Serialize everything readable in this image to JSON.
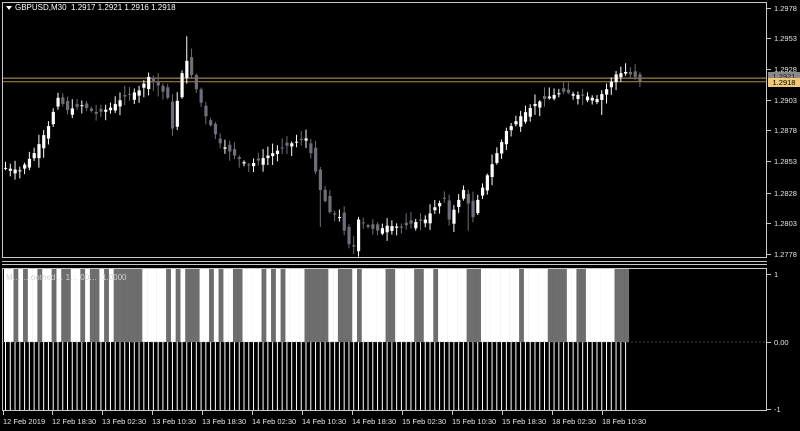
{
  "header": {
    "symbol": "GBPUSD,M30",
    "ohlc": "1.2917 1.2921 1.2916 1.2918"
  },
  "indicator": {
    "label": "M… …oothed… 1… 00… -1.0000"
  },
  "price_axis": {
    "ticks": [
      "1.2978",
      "1.2953",
      "1.2928",
      "1.2903",
      "1.2878",
      "1.2853",
      "1.2828",
      "1.2803",
      "1.2778"
    ],
    "bid_label": "1.2918",
    "ask_label": "1.2921"
  },
  "indicator_axis": {
    "ticks": [
      "1",
      "0.00",
      "-1"
    ]
  },
  "time_axis": {
    "ticks": [
      "12 Feb 2019",
      "12 Feb 18:30",
      "13 Feb 02:30",
      "13 Feb 10:30",
      "13 Feb 18:30",
      "14 Feb 02:30",
      "14 Feb 10:30",
      "14 Feb 18:30",
      "15 Feb 02:30",
      "15 Feb 10:30",
      "15 Feb 18:30",
      "18 Feb 02:30",
      "18 Feb 10:30"
    ]
  },
  "colors": {
    "background": "#000000",
    "bull": "#ffffff",
    "bear": "#6e6e78",
    "frame": "#c8c8c8",
    "bid_line": "#b08a4a",
    "ask_line": "#c0a060",
    "histogram": "#ffffff",
    "state_on": "#ffffff",
    "state_off": "#6e6e6e"
  },
  "chart_data": {
    "type": "candlestick",
    "price_range": [
      1.2768,
      1.2988
    ],
    "close_path": [
      [
        0,
        1.2848
      ],
      [
        3,
        1.2846
      ],
      [
        6,
        1.286
      ],
      [
        9,
        1.2882
      ],
      [
        11,
        1.2905
      ],
      [
        13,
        1.2895
      ],
      [
        16,
        1.2899
      ],
      [
        19,
        1.2892
      ],
      [
        22,
        1.2897
      ],
      [
        25,
        1.2906
      ],
      [
        28,
        1.2911
      ],
      [
        30,
        1.2922
      ],
      [
        32,
        1.2915
      ],
      [
        34,
        1.2905
      ],
      [
        35,
        1.288
      ],
      [
        37,
        1.2925
      ],
      [
        38,
        1.2935
      ],
      [
        40,
        1.2912
      ],
      [
        42,
        1.289
      ],
      [
        45,
        1.2868
      ],
      [
        48,
        1.2858
      ],
      [
        51,
        1.285
      ],
      [
        54,
        1.2856
      ],
      [
        57,
        1.2862
      ],
      [
        60,
        1.2868
      ],
      [
        63,
        1.2872
      ],
      [
        64,
        1.286
      ],
      [
        66,
        1.283
      ],
      [
        68,
        1.2812
      ],
      [
        70,
        1.2808
      ],
      [
        72,
        1.2786
      ],
      [
        73,
        1.2784
      ],
      [
        74,
        1.2806
      ],
      [
        76,
        1.28
      ],
      [
        78,
        1.2797
      ],
      [
        80,
        1.2801
      ],
      [
        83,
        1.28
      ],
      [
        86,
        1.2804
      ],
      [
        88,
        1.2806
      ],
      [
        90,
        1.2816
      ],
      [
        92,
        1.2823
      ],
      [
        93,
        1.2806
      ],
      [
        95,
        1.2822
      ],
      [
        96,
        1.283
      ],
      [
        98,
        1.2808
      ],
      [
        99,
        1.2822
      ],
      [
        101,
        1.2842
      ],
      [
        103,
        1.286
      ],
      [
        105,
        1.2878
      ],
      [
        108,
        1.289
      ],
      [
        111,
        1.29
      ],
      [
        114,
        1.2906
      ],
      [
        117,
        1.291
      ],
      [
        119,
        1.2908
      ],
      [
        122,
        1.2906
      ],
      [
        124,
        1.2904
      ],
      [
        126,
        1.2912
      ],
      [
        128,
        1.2924
      ],
      [
        130,
        1.2926
      ],
      [
        132,
        1.2922
      ],
      [
        133,
        1.2918
      ]
    ],
    "spikes": [
      [
        38,
        1.2955
      ],
      [
        32,
        1.2906
      ],
      [
        66,
        1.28
      ],
      [
        73,
        1.2778
      ],
      [
        97,
        1.2797
      ],
      [
        125,
        1.2891
      ]
    ],
    "bid": 1.2918,
    "ask": 1.2921,
    "indicator_states": [
      1,
      1,
      0,
      1,
      0,
      1,
      1,
      0,
      1,
      1,
      0,
      1,
      0,
      0,
      1,
      1,
      0,
      1,
      0,
      0,
      1,
      0,
      1,
      0,
      0,
      0,
      0,
      0,
      0,
      1,
      1,
      1,
      1,
      1,
      0,
      1,
      0,
      1,
      0,
      0,
      0,
      1,
      1,
      0,
      1,
      0,
      1,
      1,
      0,
      0,
      1,
      1,
      1,
      1,
      0,
      1,
      0,
      1,
      0,
      1,
      1,
      1,
      1,
      0,
      0,
      0,
      0,
      0,
      1,
      1,
      0,
      0,
      0,
      1,
      0,
      1,
      1,
      1,
      1,
      1,
      0,
      0,
      1,
      1,
      1,
      1,
      0,
      0,
      1,
      1,
      0,
      1,
      1,
      1,
      1,
      1,
      1,
      0,
      0,
      0,
      1,
      1,
      1,
      1,
      1,
      1,
      1,
      1,
      0,
      1,
      1,
      1,
      1,
      1,
      0,
      0,
      0,
      0,
      1,
      1,
      0,
      0,
      1,
      1,
      1,
      1,
      1,
      1,
      0,
      0,
      0
    ],
    "indicator_range": [
      -1,
      1
    ]
  }
}
